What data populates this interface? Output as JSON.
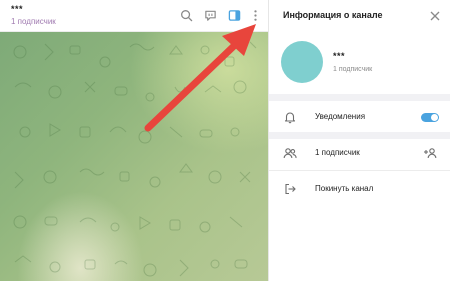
{
  "chat": {
    "title": "***",
    "subtitle": "1 подписчик"
  },
  "header_icons": [
    "search-icon",
    "discussion-icon",
    "sidebar-toggle-icon",
    "more-vertical-icon"
  ],
  "panel": {
    "title": "Информация о канале",
    "channel_name": "***",
    "subscribers": "1 подписчик",
    "rows": {
      "notifications": "Уведомления",
      "members": "1 подписчик",
      "leave": "Покинуть канал"
    },
    "notifications_enabled": true
  },
  "colors": {
    "accent": "#4aa3df",
    "avatar": "#7fcfcf",
    "arrow": "#e8453c",
    "subtitle": "#a07ab0"
  }
}
